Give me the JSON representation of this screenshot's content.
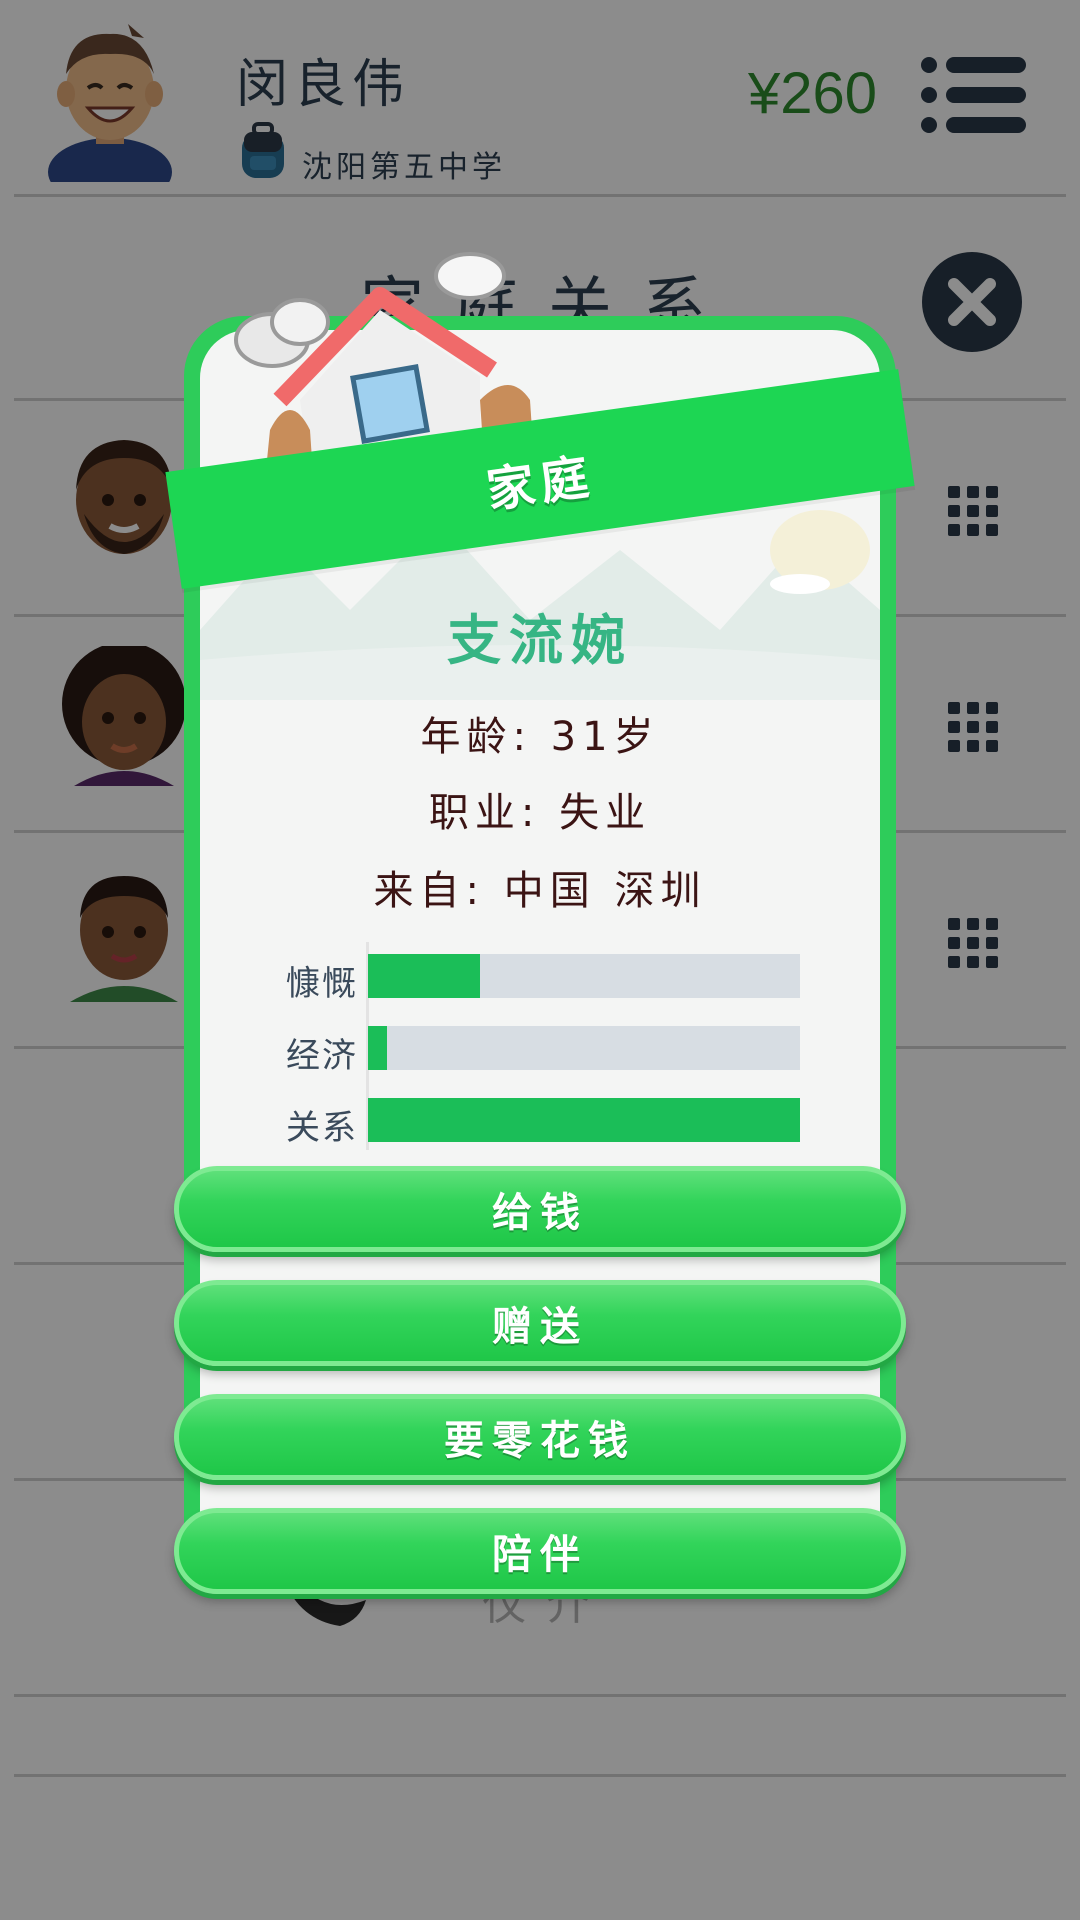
{
  "header": {
    "player_name": "闵良伟",
    "school": "沈阳第五中学",
    "money": "¥260"
  },
  "page": {
    "section_title": "家庭关系",
    "partial_text": "仅介"
  },
  "modal": {
    "banner_label": "家庭",
    "person_name": "支流婉",
    "age_line": "年龄: 31岁",
    "job_line": "职业: 失业",
    "origin_line": "来自: 中国 深圳",
    "stats": [
      {
        "label": "慷慨",
        "value": 0.26
      },
      {
        "label": "经济",
        "value": 0.045
      },
      {
        "label": "关系",
        "value": 1.0
      }
    ],
    "buttons": [
      "给钱",
      "赠送",
      "要零花钱",
      "陪伴"
    ]
  },
  "colors": {
    "accent_green": "#1dd653",
    "money_green": "#2f8a2f",
    "bar_fill": "#1bbe58",
    "bar_track": "#d7dde3",
    "name_teal": "#36b584"
  },
  "icons": {
    "menu": "hamburger-list-icon",
    "close": "close-x-icon",
    "grid": "grid-dots-icon",
    "school": "backpack-icon"
  }
}
